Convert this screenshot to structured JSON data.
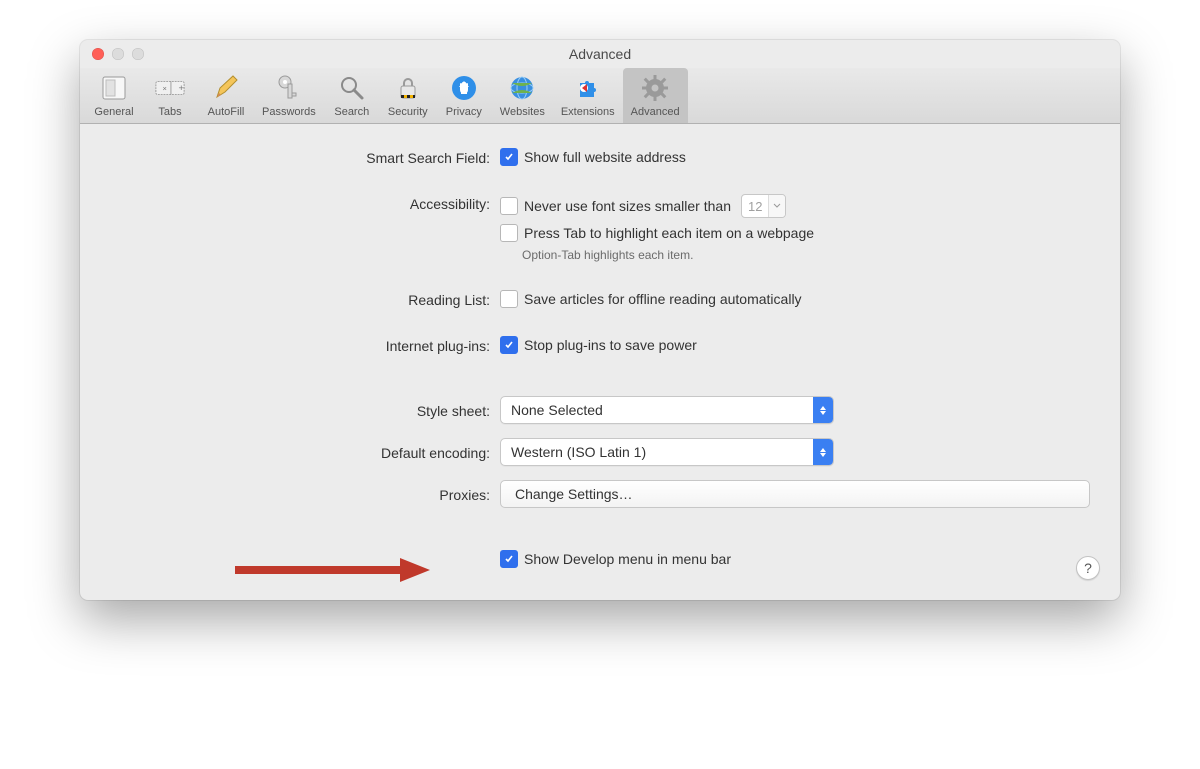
{
  "window": {
    "title": "Advanced"
  },
  "toolbar": {
    "items": [
      {
        "label": "General"
      },
      {
        "label": "Tabs"
      },
      {
        "label": "AutoFill"
      },
      {
        "label": "Passwords"
      },
      {
        "label": "Search"
      },
      {
        "label": "Security"
      },
      {
        "label": "Privacy"
      },
      {
        "label": "Websites"
      },
      {
        "label": "Extensions"
      },
      {
        "label": "Advanced"
      }
    ]
  },
  "sections": {
    "smart_search": {
      "label": "Smart Search Field:",
      "show_full_address": {
        "checked": true,
        "text": "Show full website address"
      }
    },
    "accessibility": {
      "label": "Accessibility:",
      "font_size": {
        "checked": false,
        "text": "Never use font sizes smaller than",
        "value": "12"
      },
      "tab_highlight": {
        "checked": false,
        "text": "Press Tab to highlight each item on a webpage"
      },
      "note": "Option-Tab highlights each item."
    },
    "reading_list": {
      "label": "Reading List:",
      "offline": {
        "checked": false,
        "text": "Save articles for offline reading automatically"
      }
    },
    "plugins": {
      "label": "Internet plug-ins:",
      "stop": {
        "checked": true,
        "text": "Stop plug-ins to save power"
      }
    },
    "style_sheet": {
      "label": "Style sheet:",
      "value": "None Selected"
    },
    "encoding": {
      "label": "Default encoding:",
      "value": "Western (ISO Latin 1)"
    },
    "proxies": {
      "label": "Proxies:",
      "button": "Change Settings…"
    },
    "develop": {
      "checked": true,
      "text": "Show Develop menu in menu bar"
    }
  },
  "help": "?"
}
